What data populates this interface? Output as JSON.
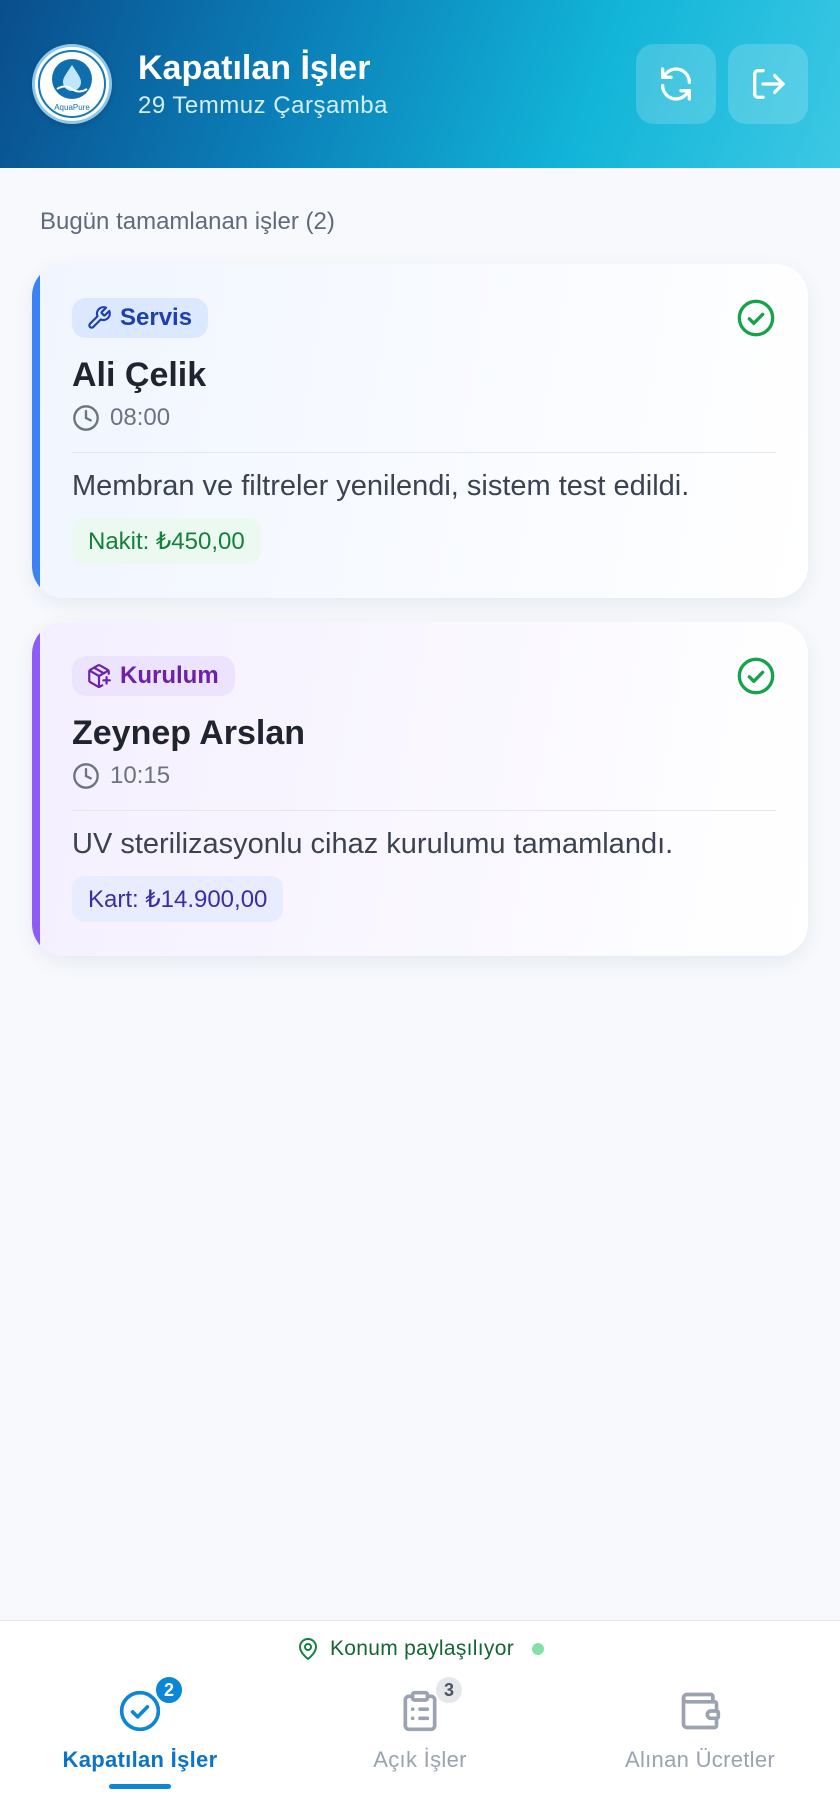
{
  "header": {
    "logo_text": "AquaPure",
    "title": "Kapatılan İşler",
    "subtitle": "29 Temmuz Çarşamba",
    "refresh_icon": "refresh-icon",
    "logout_icon": "logout-icon"
  },
  "section": {
    "label": "Bugün tamamlanan işler (2)"
  },
  "jobs": [
    {
      "type_label": "Servis",
      "type_icon": "wrench-icon",
      "customer": "Ali Çelik",
      "time": "08:00",
      "description": "Membran ve filtreler yenilendi, sistem test edildi.",
      "payment": "Nakit: ₺450,00",
      "accent": "#3b82f6"
    },
    {
      "type_label": "Kurulum",
      "type_icon": "package-plus-icon",
      "customer": "Zeynep Arslan",
      "time": "10:15",
      "description": "UV sterilizasyonlu cihaz kurulumu tamamlandı.",
      "payment": "Kart: ₺14.900,00",
      "accent": "#8b5cf6"
    }
  ],
  "status": {
    "location": "Konum paylaşılıyor"
  },
  "nav": [
    {
      "label": "Kapatılan İşler",
      "badge": "2",
      "icon": "check-circle-icon",
      "active": true
    },
    {
      "label": "Açık İşler",
      "badge": "3",
      "icon": "clipboard-list-icon",
      "active": false
    },
    {
      "label": "Alınan Ücretler",
      "badge": "",
      "icon": "wallet-icon",
      "active": false
    }
  ],
  "colors": {
    "primary": "#0b87d6",
    "success": "#16a34a"
  }
}
